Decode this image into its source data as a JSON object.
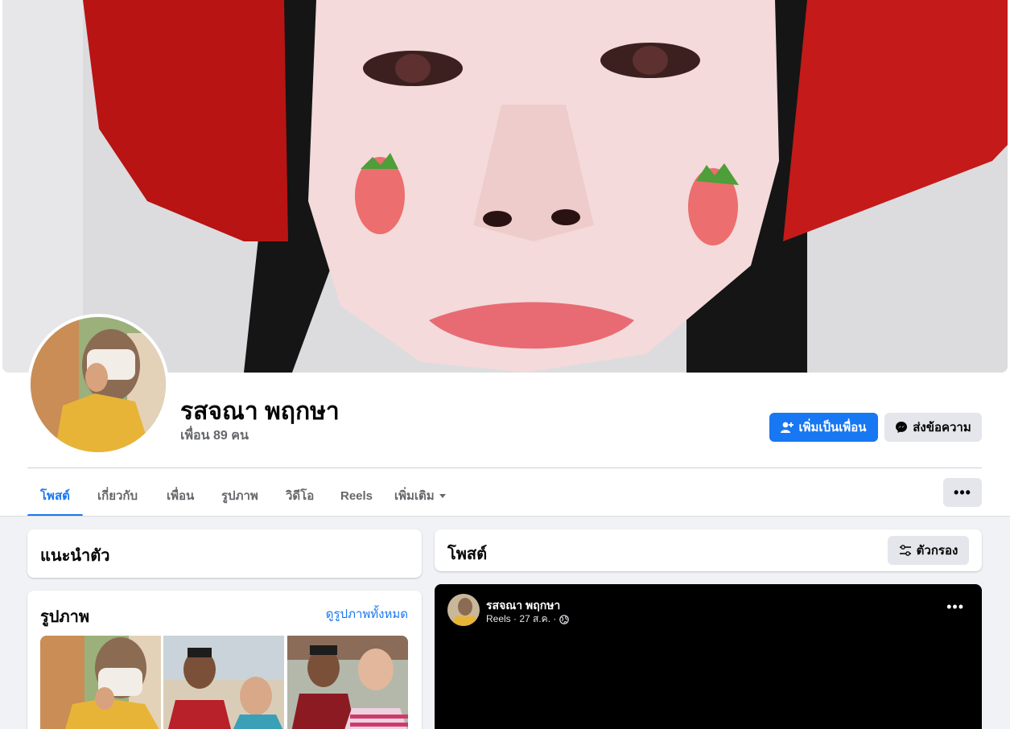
{
  "profile": {
    "name": "รสจณา พฤกษา",
    "friends_count": "เพื่อน 89 คน",
    "cover_description": "close-up face with strawberry stickers",
    "add_friend_label": "เพิ่มเป็นเพื่อน",
    "message_label": "ส่งข้อความ",
    "more_label": "•••"
  },
  "tabs": [
    {
      "label": "โพสต์",
      "active": true
    },
    {
      "label": "เกี่ยวกับ",
      "active": false
    },
    {
      "label": "เพื่อน",
      "active": false
    },
    {
      "label": "รูปภาพ",
      "active": false
    },
    {
      "label": "วิดีโอ",
      "active": false
    },
    {
      "label": "Reels",
      "active": false
    },
    {
      "label": "เพิ่มเติม",
      "active": false
    }
  ],
  "intro": {
    "title": "แนะนำตัว"
  },
  "photos": {
    "title": "รูปภาพ",
    "see_all": "ดูรูปภาพทั้งหมด"
  },
  "posts": {
    "title": "โพสต์",
    "filter_label": "ตัวกรอง"
  },
  "reel_post": {
    "author": "รสจณา พฤกษา",
    "meta": "Reels · 27 ส.ค. ·",
    "more_label": "•••"
  },
  "colors": {
    "accent": "#1877f2",
    "background": "#f0f2f5",
    "secondary_button": "#e4e6eb"
  },
  "icons": {
    "add_friend": "add-friend-icon",
    "messenger": "messenger-icon",
    "filter": "filter-icon",
    "globe": "globe-icon"
  }
}
